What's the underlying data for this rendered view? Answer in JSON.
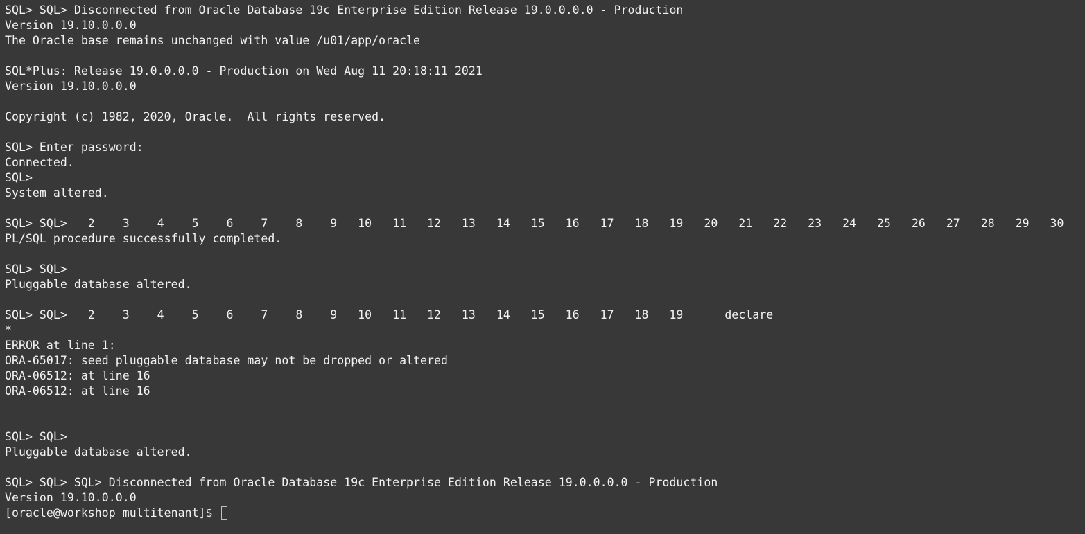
{
  "terminal": {
    "lines": [
      "SQL> SQL> Disconnected from Oracle Database 19c Enterprise Edition Release 19.0.0.0.0 - Production",
      "Version 19.10.0.0.0",
      "The Oracle base remains unchanged with value /u01/app/oracle",
      "",
      "SQL*Plus: Release 19.0.0.0.0 - Production on Wed Aug 11 20:18:11 2021",
      "Version 19.10.0.0.0",
      "",
      "Copyright (c) 1982, 2020, Oracle.  All rights reserved.",
      "",
      "SQL> Enter password:",
      "Connected.",
      "SQL>",
      "System altered.",
      "",
      "SQL> SQL>   2    3    4    5    6    7    8    9   10   11   12   13   14   15   16   17   18   19   20   21   22   23   24   25   26   27   28   29   30",
      "PL/SQL procedure successfully completed.",
      "",
      "SQL> SQL>",
      "Pluggable database altered.",
      "",
      "SQL> SQL>   2    3    4    5    6    7    8    9   10   11   12   13   14   15   16   17   18   19      declare",
      "*",
      "ERROR at line 1:",
      "ORA-65017: seed pluggable database may not be dropped or altered",
      "ORA-06512: at line 16",
      "ORA-06512: at line 16",
      "",
      "",
      "SQL> SQL>",
      "Pluggable database altered.",
      "",
      "SQL> SQL> SQL> Disconnected from Oracle Database 19c Enterprise Edition Release 19.0.0.0.0 - Production",
      "Version 19.10.0.0.0"
    ],
    "prompt": "[oracle@workshop multitenant]$ "
  }
}
